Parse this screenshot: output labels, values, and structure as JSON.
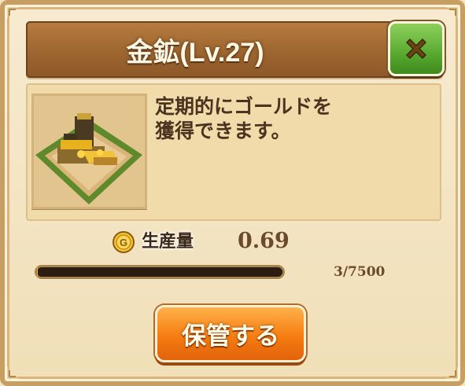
{
  "dialog": {
    "title": "金鉱(Lv.27)",
    "description": "定期的にゴールドを\n獲得できます。",
    "close_icon": "close-x-icon",
    "thumbnail": "gold-mine-building-image"
  },
  "production": {
    "icon": "gold-coin-icon",
    "label": "生産量",
    "value": "0.69"
  },
  "storage": {
    "current": 3,
    "max": 7500,
    "text": "3/7500",
    "fill_fraction": 0.0004
  },
  "actions": {
    "store_label": "保管する"
  },
  "colors": {
    "title_bar": "#9d6630",
    "close_button": "#58a92f",
    "store_button": "#f57d12",
    "panel": "#f1dbab",
    "progress_fill": "#f0b023"
  }
}
